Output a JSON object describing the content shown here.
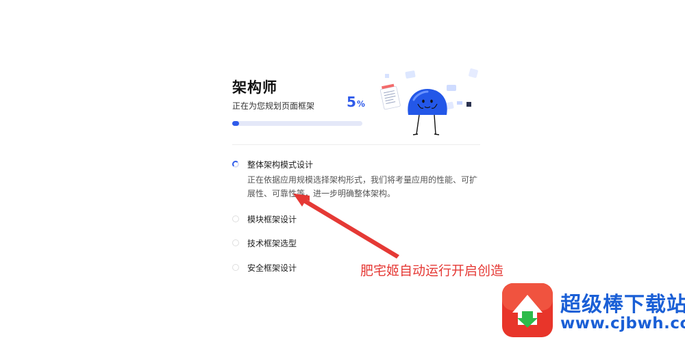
{
  "header": {
    "title": "架构师",
    "subtitle": "正在为您规划页面框架",
    "progress_value": "5",
    "progress_unit": "%",
    "progress_fraction": 0.05
  },
  "steps": [
    {
      "label": "整体架构模式设计",
      "description": "正在依据应用规模选择架构形式，我们将考量应用的性能、可扩展性、可靠性等，进一步明确整体架构。",
      "state": "active"
    },
    {
      "label": "模块框架设计",
      "state": "pending"
    },
    {
      "label": "技术框架选型",
      "state": "pending"
    },
    {
      "label": "安全框架设计",
      "state": "pending"
    }
  ],
  "annotation": {
    "text": "肥宅姬自动运行开启创造",
    "color": "#e53935"
  },
  "watermark": {
    "name": "超级棒下载站",
    "url": "www.cjbwh.com"
  },
  "colors": {
    "accent": "#2f5bea",
    "annotation": "#e53935",
    "watermark": "#1a5fd6"
  }
}
